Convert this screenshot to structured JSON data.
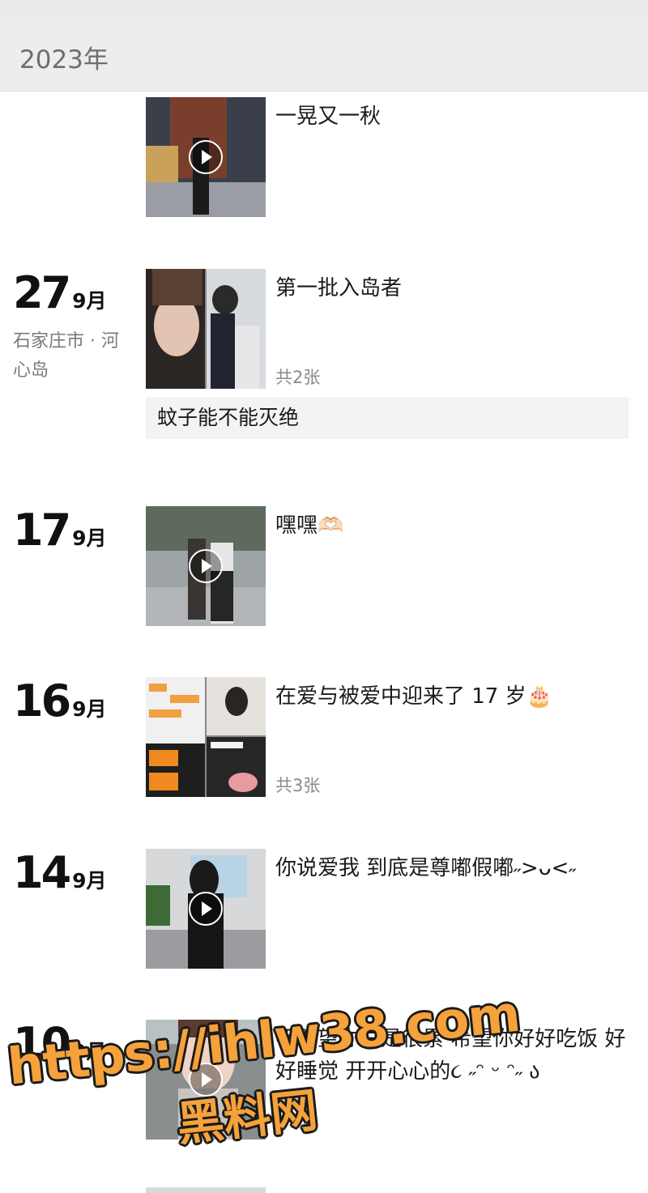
{
  "header": {
    "year": "2023年"
  },
  "entries": [
    {
      "text": "一晃又一秋",
      "type": "video",
      "icon": "play-icon"
    },
    {
      "day": "27",
      "month": "9月",
      "location": "石家庄市 · 河心岛",
      "text": "第一批入岛者",
      "type": "photos",
      "count": "共2张",
      "comment": "蚊子能不能灭绝"
    },
    {
      "day": "17",
      "month": "9月",
      "text": "嘿嘿🫶🏻",
      "type": "video",
      "icon": "play-icon"
    },
    {
      "day": "16",
      "month": "9月",
      "text": "在爱与被爱中迎来了 17 岁🎂",
      "type": "photos",
      "count": "共3张"
    },
    {
      "day": "14",
      "month": "9月",
      "text": "你说爱我 到底是尊嘟假嘟˶>ᴗ<˶",
      "type": "video",
      "icon": "play-icon"
    },
    {
      "day": "10",
      "month": "9月",
      "text": "不希望你总是很累 希望你好好吃饭 好好睡觉 开开心心的૮ ˶ᵔ ᵕ ᵔ˶ ა",
      "type": "video",
      "icon": "play-icon"
    }
  ],
  "watermark": {
    "line1": "https://ihlw38.com",
    "line2": "黑料网"
  }
}
